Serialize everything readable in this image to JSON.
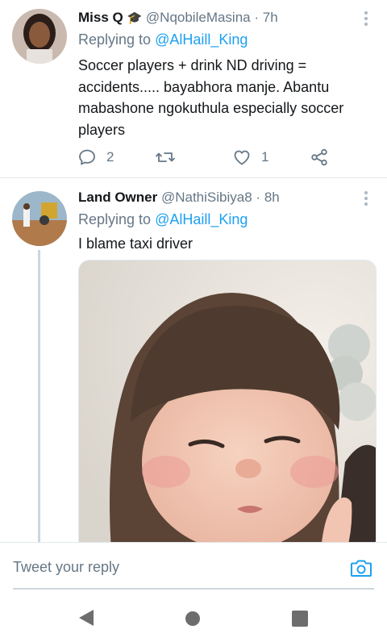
{
  "tweets": [
    {
      "name": "Miss Q",
      "name_emoji": "🎓",
      "handle": "@NqobileMasina",
      "sep": "·",
      "time": "7h",
      "replying_prefix": "Replying to",
      "replying_to": "@AlHaill_King",
      "text_lines": [
        "Soccer players + drink ND driving =",
        "accidents..... bayabhora manje. Abantu",
        "mabashone ngokuthula especially soccer",
        "players"
      ],
      "reply_count": "2",
      "retweet_count": "",
      "like_count": "1"
    },
    {
      "name": "Land Owner",
      "handle": "@NathiSibiya8",
      "sep": "·",
      "time": "8h",
      "replying_prefix": "Replying to",
      "replying_to": "@AlHaill_King",
      "text": "I blame taxi driver"
    }
  ],
  "composer": {
    "placeholder": "Tweet your reply"
  },
  "icons": {
    "reply": "reply-icon",
    "retweet": "retweet-icon",
    "like": "heart-icon",
    "share": "share-icon",
    "more": "more-vertical-icon",
    "camera": "camera-icon",
    "back": "back-triangle-icon",
    "home": "home-circle-icon",
    "recents": "recents-square-icon"
  },
  "colors": {
    "accent": "#1da1f2",
    "secondary_text": "#657786",
    "divider": "#e1e8ed"
  }
}
